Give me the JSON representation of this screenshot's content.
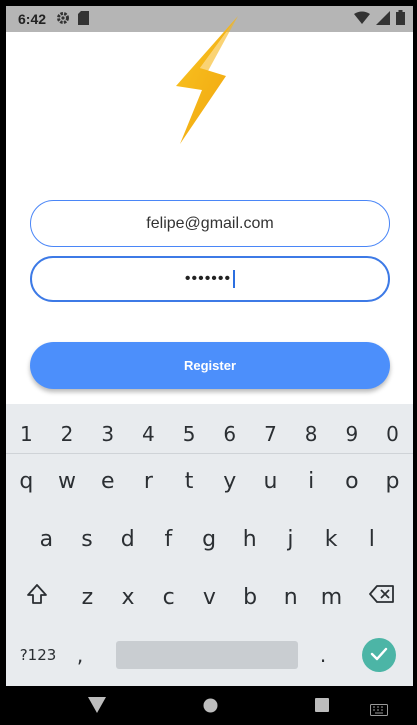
{
  "status_bar": {
    "time": "6:42",
    "icons_left": [
      "settings-icon",
      "sd-card-icon"
    ],
    "icons_right": [
      "wifi-icon",
      "signal-icon",
      "battery-icon"
    ]
  },
  "form": {
    "email_value": "felipe@gmail.com",
    "password_mask": "•••••••",
    "register_label": "Register"
  },
  "keyboard": {
    "number_row": [
      "1",
      "2",
      "3",
      "4",
      "5",
      "6",
      "7",
      "8",
      "9",
      "0"
    ],
    "row1": [
      "q",
      "w",
      "e",
      "r",
      "t",
      "y",
      "u",
      "i",
      "o",
      "p"
    ],
    "row2": [
      "a",
      "s",
      "d",
      "f",
      "g",
      "h",
      "j",
      "k",
      "l"
    ],
    "row3": [
      "z",
      "x",
      "c",
      "v",
      "b",
      "n",
      "m"
    ],
    "symbols_label": "?123",
    "comma": ",",
    "period": "."
  },
  "colors": {
    "accent": "#4c8ffb",
    "field_border": "#4a86f7",
    "logo_gold": "#f5b21c",
    "enter_key": "#4cb5a6",
    "keyboard_bg": "#e8ebee"
  }
}
